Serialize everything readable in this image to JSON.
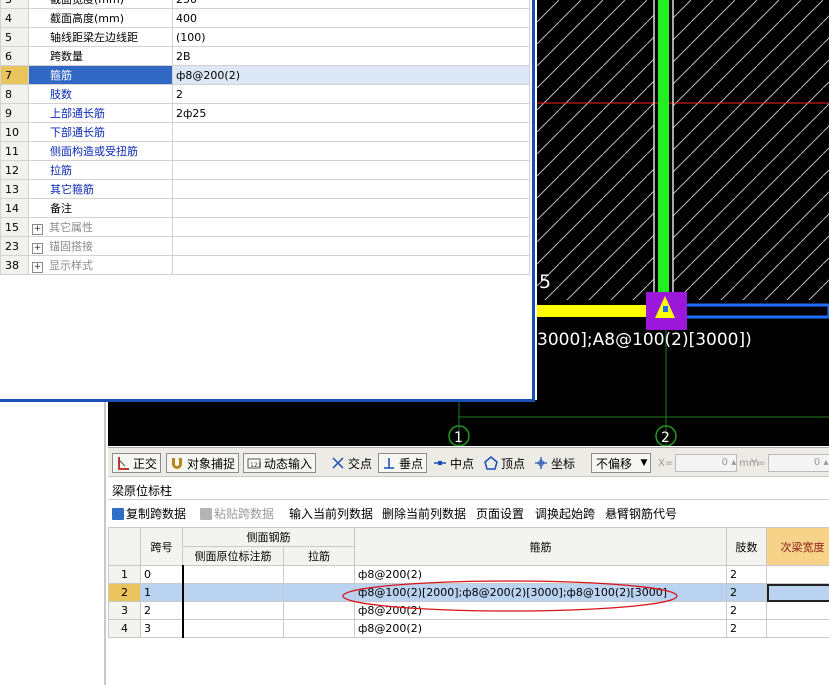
{
  "property_panel": {
    "rows": [
      {
        "num": "3",
        "name": "截面宽度(mm)",
        "value": "250",
        "style": "normal"
      },
      {
        "num": "4",
        "name": "截面高度(mm)",
        "value": "400",
        "style": "normal"
      },
      {
        "num": "5",
        "name": "轴线距梁左边线距",
        "value": "(100)",
        "style": "normal"
      },
      {
        "num": "6",
        "name": "跨数量",
        "value": "2B",
        "style": "normal"
      },
      {
        "num": "7",
        "name": "箍筋",
        "value": "ф8@200(2)",
        "style": "selected"
      },
      {
        "num": "8",
        "name": "肢数",
        "value": "2",
        "style": "blue"
      },
      {
        "num": "9",
        "name": "上部通长筋",
        "value": "2ф25",
        "style": "blue"
      },
      {
        "num": "10",
        "name": "下部通长筋",
        "value": "",
        "style": "blue"
      },
      {
        "num": "11",
        "name": "侧面构造或受扭筋",
        "value": "",
        "style": "blue"
      },
      {
        "num": "12",
        "name": "拉筋",
        "value": "",
        "style": "blue"
      },
      {
        "num": "13",
        "name": "其它箍筋",
        "value": "",
        "style": "blue"
      },
      {
        "num": "14",
        "name": "备注",
        "value": "",
        "style": "normal"
      },
      {
        "num": "15",
        "name": "其它属性",
        "value": "",
        "style": "group"
      },
      {
        "num": "23",
        "name": "锚固搭接",
        "value": "",
        "style": "group"
      },
      {
        "num": "38",
        "name": "显示样式",
        "value": "",
        "style": "group"
      }
    ]
  },
  "cad": {
    "label_span": "5",
    "label_rebar": "3000];A8@100(2)[3000])",
    "axis_1": "1",
    "axis_2": "2",
    "dim_1": "3000",
    "dim_2": "3000",
    "colors": {
      "green": "#22ee22",
      "yellow": "#ffff00",
      "purple": "#9b17d9",
      "blue": "#1e6fff",
      "red": "#ff2020"
    }
  },
  "snap_toolbar": {
    "ortho": "正交",
    "object_snap": "对象捕捉",
    "dynamic_input": "动态输入",
    "intersection": "交点",
    "perpendicular": "垂点",
    "midpoint": "中点",
    "vertex": "顶点",
    "coordinate": "坐标",
    "offset_mode": "不偏移",
    "x_label": "X=",
    "x_value": "0",
    "x_unit": "mm",
    "y_label": "Y=",
    "y_value": "0",
    "y_unit": "mm"
  },
  "panel": {
    "title": "梁原位标柱",
    "toolbar": {
      "copy_span": "复制跨数据",
      "paste_span": "粘贴跨数据",
      "input_column": "输入当前列数据",
      "delete_column": "删除当前列数据",
      "page_setup": "页面设置",
      "swap_start": "调换起始跨",
      "cantilever_code": "悬臂钢筋代号"
    }
  },
  "grid": {
    "headers": {
      "span": "跨号",
      "side_rebar": "侧面钢筋",
      "side_mark": "侧面原位标注筋",
      "tie": "拉筋",
      "stirrup": "箍筋",
      "legs": "肢数",
      "secondary_width": "次梁宽度"
    },
    "rows": [
      {
        "rn": "1",
        "span": "0",
        "side_mark": "",
        "tie": "",
        "stirrup": "ф8@200(2)",
        "legs": "2"
      },
      {
        "rn": "2",
        "span": "1",
        "side_mark": "",
        "tie": "",
        "stirrup": "ф8@100(2)[2000];ф8@200(2)[3000];ф8@100(2)[3000]",
        "legs": "2"
      },
      {
        "rn": "3",
        "span": "2",
        "side_mark": "",
        "tie": "",
        "stirrup": "ф8@200(2)",
        "legs": "2"
      },
      {
        "rn": "4",
        "span": "3",
        "side_mark": "",
        "tie": "",
        "stirrup": "ф8@200(2)",
        "legs": "2"
      }
    ]
  }
}
